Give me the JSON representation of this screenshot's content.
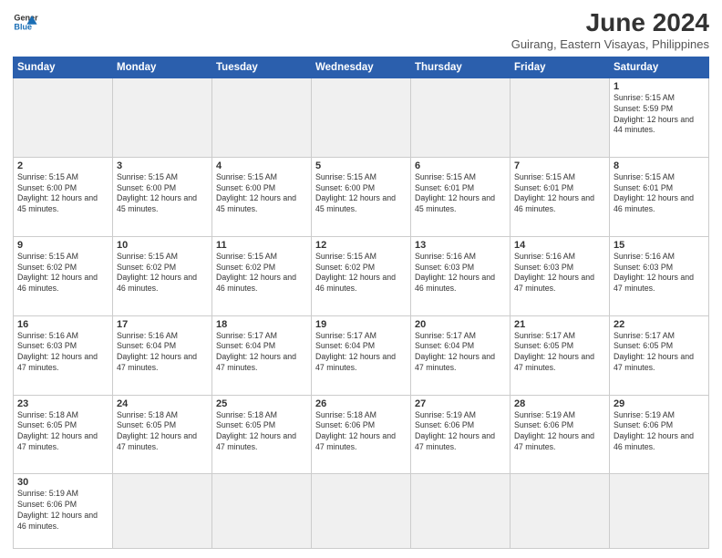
{
  "header": {
    "logo_general": "General",
    "logo_blue": "Blue",
    "month_title": "June 2024",
    "location": "Guirang, Eastern Visayas, Philippines"
  },
  "days_of_week": [
    "Sunday",
    "Monday",
    "Tuesday",
    "Wednesday",
    "Thursday",
    "Friday",
    "Saturday"
  ],
  "weeks": [
    [
      {
        "day": "",
        "empty": true
      },
      {
        "day": "",
        "empty": true
      },
      {
        "day": "",
        "empty": true
      },
      {
        "day": "",
        "empty": true
      },
      {
        "day": "",
        "empty": true
      },
      {
        "day": "",
        "empty": true
      },
      {
        "day": "1",
        "sunrise": "5:15 AM",
        "sunset": "5:59 PM",
        "daylight": "12 hours and 44 minutes."
      }
    ],
    [
      {
        "day": "2",
        "sunrise": "5:15 AM",
        "sunset": "6:00 PM",
        "daylight": "12 hours and 45 minutes."
      },
      {
        "day": "3",
        "sunrise": "5:15 AM",
        "sunset": "6:00 PM",
        "daylight": "12 hours and 45 minutes."
      },
      {
        "day": "4",
        "sunrise": "5:15 AM",
        "sunset": "6:00 PM",
        "daylight": "12 hours and 45 minutes."
      },
      {
        "day": "5",
        "sunrise": "5:15 AM",
        "sunset": "6:00 PM",
        "daylight": "12 hours and 45 minutes."
      },
      {
        "day": "6",
        "sunrise": "5:15 AM",
        "sunset": "6:01 PM",
        "daylight": "12 hours and 45 minutes."
      },
      {
        "day": "7",
        "sunrise": "5:15 AM",
        "sunset": "6:01 PM",
        "daylight": "12 hours and 46 minutes."
      },
      {
        "day": "8",
        "sunrise": "5:15 AM",
        "sunset": "6:01 PM",
        "daylight": "12 hours and 46 minutes."
      }
    ],
    [
      {
        "day": "9",
        "sunrise": "5:15 AM",
        "sunset": "6:02 PM",
        "daylight": "12 hours and 46 minutes."
      },
      {
        "day": "10",
        "sunrise": "5:15 AM",
        "sunset": "6:02 PM",
        "daylight": "12 hours and 46 minutes."
      },
      {
        "day": "11",
        "sunrise": "5:15 AM",
        "sunset": "6:02 PM",
        "daylight": "12 hours and 46 minutes."
      },
      {
        "day": "12",
        "sunrise": "5:15 AM",
        "sunset": "6:02 PM",
        "daylight": "12 hours and 46 minutes."
      },
      {
        "day": "13",
        "sunrise": "5:16 AM",
        "sunset": "6:03 PM",
        "daylight": "12 hours and 46 minutes."
      },
      {
        "day": "14",
        "sunrise": "5:16 AM",
        "sunset": "6:03 PM",
        "daylight": "12 hours and 47 minutes."
      },
      {
        "day": "15",
        "sunrise": "5:16 AM",
        "sunset": "6:03 PM",
        "daylight": "12 hours and 47 minutes."
      }
    ],
    [
      {
        "day": "16",
        "sunrise": "5:16 AM",
        "sunset": "6:03 PM",
        "daylight": "12 hours and 47 minutes."
      },
      {
        "day": "17",
        "sunrise": "5:16 AM",
        "sunset": "6:04 PM",
        "daylight": "12 hours and 47 minutes."
      },
      {
        "day": "18",
        "sunrise": "5:17 AM",
        "sunset": "6:04 PM",
        "daylight": "12 hours and 47 minutes."
      },
      {
        "day": "19",
        "sunrise": "5:17 AM",
        "sunset": "6:04 PM",
        "daylight": "12 hours and 47 minutes."
      },
      {
        "day": "20",
        "sunrise": "5:17 AM",
        "sunset": "6:04 PM",
        "daylight": "12 hours and 47 minutes."
      },
      {
        "day": "21",
        "sunrise": "5:17 AM",
        "sunset": "6:05 PM",
        "daylight": "12 hours and 47 minutes."
      },
      {
        "day": "22",
        "sunrise": "5:17 AM",
        "sunset": "6:05 PM",
        "daylight": "12 hours and 47 minutes."
      }
    ],
    [
      {
        "day": "23",
        "sunrise": "5:18 AM",
        "sunset": "6:05 PM",
        "daylight": "12 hours and 47 minutes."
      },
      {
        "day": "24",
        "sunrise": "5:18 AM",
        "sunset": "6:05 PM",
        "daylight": "12 hours and 47 minutes."
      },
      {
        "day": "25",
        "sunrise": "5:18 AM",
        "sunset": "6:05 PM",
        "daylight": "12 hours and 47 minutes."
      },
      {
        "day": "26",
        "sunrise": "5:18 AM",
        "sunset": "6:06 PM",
        "daylight": "12 hours and 47 minutes."
      },
      {
        "day": "27",
        "sunrise": "5:19 AM",
        "sunset": "6:06 PM",
        "daylight": "12 hours and 47 minutes."
      },
      {
        "day": "28",
        "sunrise": "5:19 AM",
        "sunset": "6:06 PM",
        "daylight": "12 hours and 47 minutes."
      },
      {
        "day": "29",
        "sunrise": "5:19 AM",
        "sunset": "6:06 PM",
        "daylight": "12 hours and 46 minutes."
      }
    ],
    [
      {
        "day": "30",
        "sunrise": "5:19 AM",
        "sunset": "6:06 PM",
        "daylight": "12 hours and 46 minutes."
      },
      {
        "day": "",
        "empty": true
      },
      {
        "day": "",
        "empty": true
      },
      {
        "day": "",
        "empty": true
      },
      {
        "day": "",
        "empty": true
      },
      {
        "day": "",
        "empty": true
      },
      {
        "day": "",
        "empty": true
      }
    ]
  ]
}
